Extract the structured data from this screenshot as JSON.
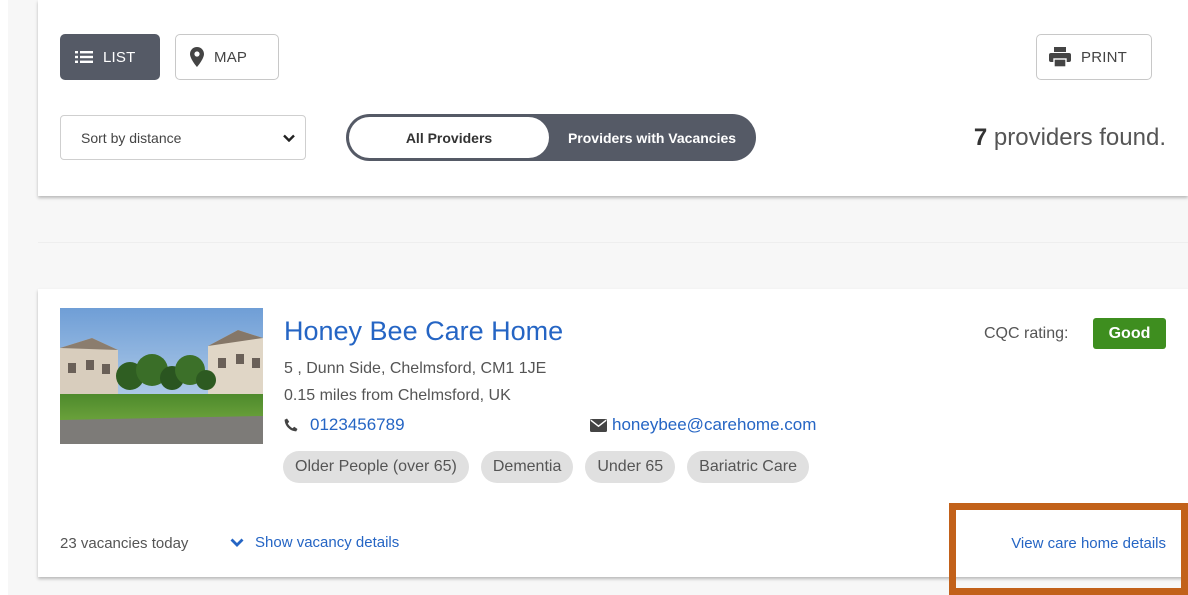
{
  "toolbar": {
    "list_label": "LIST",
    "map_label": "MAP",
    "print_label": "PRINT"
  },
  "filters": {
    "sort_selected": "Sort by distance",
    "toggle_all": "All Providers",
    "toggle_vacancies": "Providers with Vacancies",
    "results_count": "7",
    "results_suffix": " providers found."
  },
  "provider": {
    "name": "Honey Bee Care Home",
    "address": "5 , Dunn Side, Chelmsford, CM1 1JE",
    "distance": "0.15 miles from Chelmsford, UK",
    "phone": "0123456789",
    "email": "honeybee@carehome.com",
    "tags": [
      "Older People (over 65)",
      "Dementia",
      "Under 65",
      "Bariatric Care"
    ],
    "cqc_label": "CQC rating:",
    "cqc_rating": "Good",
    "vacancies": "23 vacancies today",
    "show_vacancy_label": "Show vacancy details",
    "view_details_label": "View care home details"
  },
  "colors": {
    "accent_blue": "#2565c4",
    "dark_button": "#555a66",
    "good_green": "#3e8e1f",
    "highlight": "#c2611a"
  },
  "icons": {
    "list": "list-icon",
    "map": "map-pin-icon",
    "print": "printer-icon",
    "dropdown": "chevron-down-icon",
    "phone": "phone-icon",
    "email": "envelope-icon",
    "expand": "chevron-down-icon"
  }
}
